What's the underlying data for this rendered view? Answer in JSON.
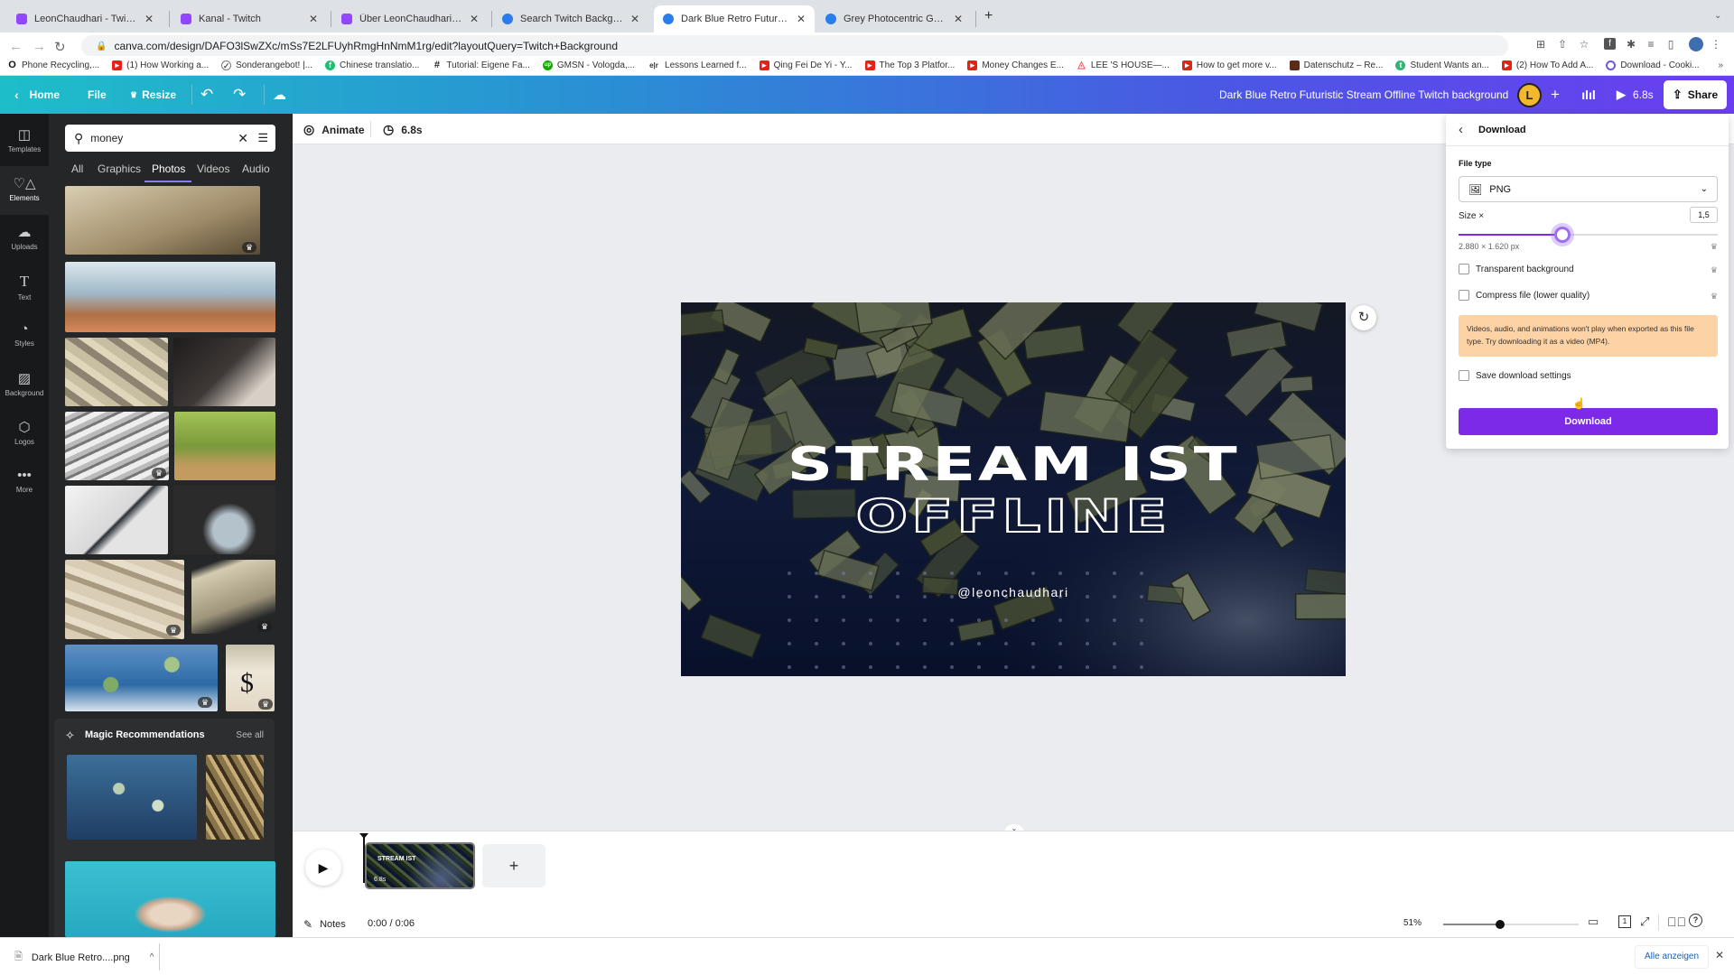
{
  "browser": {
    "tabs": [
      {
        "title": "LeonChaudhari - Twitch",
        "icon": "twitch-icon",
        "active": false
      },
      {
        "title": "Kanal - Twitch",
        "icon": "twitch-icon",
        "active": false
      },
      {
        "title": "Über LeonChaudhari - Twitch",
        "icon": "twitch-icon",
        "active": false
      },
      {
        "title": "Search Twitch Background - C",
        "icon": "canva-icon",
        "active": false
      },
      {
        "title": "Dark Blue Retro Futuristic Stre",
        "icon": "canva-icon",
        "active": true
      },
      {
        "title": "Grey Photocentric Game Night",
        "icon": "canva-icon",
        "active": false
      }
    ],
    "new_tab": "+",
    "url": "canva.com/design/DAFO3lSwZXc/mSs7E2LFUyhRmgHnNmM1rg/edit?layoutQuery=Twitch+Background",
    "bookmarks": [
      {
        "label": "Phone Recycling,...",
        "icon": "o2-icon"
      },
      {
        "label": "(1) How Working a...",
        "icon": "youtube-icon"
      },
      {
        "label": "Sonderangebot! |...",
        "icon": "check-badge-icon"
      },
      {
        "label": "Chinese translatio...",
        "icon": "fiverr-icon"
      },
      {
        "label": "Tutorial: Eigene Fa...",
        "icon": "hash-icon"
      },
      {
        "label": "GMSN - Vologda,...",
        "icon": "upwork-icon"
      },
      {
        "label": "Lessons Learned f...",
        "icon": "eir-icon"
      },
      {
        "label": "Qing Fei De Yi - Y...",
        "icon": "youtube-icon"
      },
      {
        "label": "The Top 3 Platfor...",
        "icon": "youtube-icon"
      },
      {
        "label": "Money Changes E...",
        "icon": "youtube-icon"
      },
      {
        "label": "LEE 'S HOUSE—...",
        "icon": "airbnb-icon"
      },
      {
        "label": "How to get more v...",
        "icon": "youtube-icon"
      },
      {
        "label": "Datenschutz – Re...",
        "icon": "site-icon"
      },
      {
        "label": "Student Wants an...",
        "icon": "t-icon"
      },
      {
        "label": "(2) How To Add A...",
        "icon": "youtube-icon"
      },
      {
        "label": "Download - Cooki...",
        "icon": "cookie-icon"
      }
    ]
  },
  "header": {
    "home": "Home",
    "file": "File",
    "resize": "Resize",
    "design_title": "Dark Blue Retro Futuristic Stream Offline Twitch background",
    "avatar_letter": "L",
    "play_duration": "6.8s",
    "share": "Share"
  },
  "rail": [
    {
      "label": "Templates",
      "icon": "templates-icon"
    },
    {
      "label": "Elements",
      "icon": "elements-icon",
      "selected": true
    },
    {
      "label": "Uploads",
      "icon": "upload-cloud-icon"
    },
    {
      "label": "Text",
      "icon": "text-icon"
    },
    {
      "label": "Styles",
      "icon": "palette-icon"
    },
    {
      "label": "Background",
      "icon": "background-icon"
    },
    {
      "label": "Logos",
      "icon": "logo-icon"
    },
    {
      "label": "More",
      "icon": "more-dots-icon"
    }
  ],
  "panel": {
    "search_value": "money",
    "tabs": [
      "All",
      "Graphics",
      "Photos",
      "Videos",
      "Audio"
    ],
    "selected_tab": "Photos",
    "magic_title": "Magic Recommendations",
    "see_all": "See all"
  },
  "toolbar": {
    "animate": "Animate",
    "duration": "6.8s"
  },
  "design": {
    "line1": "STREAM IST",
    "line2": "OFFLINE",
    "handle": "@leonchaudhari"
  },
  "download": {
    "title": "Download",
    "file_type_label": "File type",
    "file_type": "PNG",
    "size_label": "Size ×",
    "size_value": "1,5",
    "size_slider_fraction": 0.4,
    "dimensions": "2.880 × 1.620 px",
    "transparent_label": "Transparent background",
    "compress_label": "Compress file (lower quality)",
    "warning": "Videos, audio, and animations won't play when exported as this file type. Try downloading it as a video (MP4).",
    "save_settings_label": "Save download settings",
    "button": "Download",
    "accent": "#7d2ae8",
    "warning_bg": "#fdd2a4"
  },
  "timeline": {
    "page_duration": "6.8s",
    "page_thumb_text": "STREAM IST",
    "notes": "Notes",
    "time": "0:00 / 0:06",
    "zoom": "51%",
    "zoom_fraction": 0.42,
    "add_page": "+"
  },
  "shelf": {
    "file": "Dark Blue Retro....png",
    "show_all": "Alle anzeigen"
  }
}
